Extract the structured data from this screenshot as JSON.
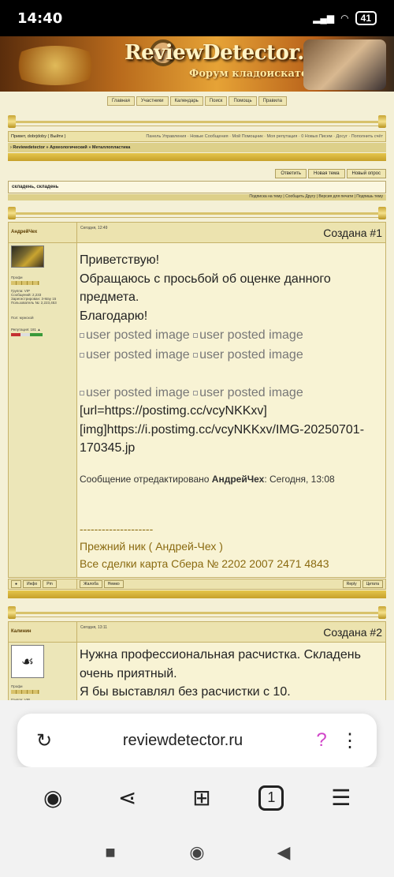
{
  "status": {
    "time": "14:40",
    "battery": "41"
  },
  "banner": {
    "logo": "ReviewDetector.ru",
    "subtitle": "Форум кладоискателей"
  },
  "forum_nav": [
    "Главная",
    "Участники",
    "Календарь",
    "Поиск",
    "Помощь",
    "Правила"
  ],
  "userbar": {
    "left": "Привет, dobrjdoby ( Выйти )",
    "right": "Панель Управления · Новые Сообщения · Мой Помощник · Моя репутация · 0 Новых Писем · Досуг · Пополнить счёт"
  },
  "breadcrumbs": "› Reviewdetector » Археологический » Металлопластика",
  "actions": {
    "reply": "Ответить",
    "new_topic": "Новая тема",
    "new_poll": "Новый опрос"
  },
  "topic_title": "складень, складень",
  "topic_options": "Подписка на тему | Сообщить Другу | Версия для печати | Подпишь тему",
  "post1": {
    "author": "АндрейЧех",
    "date": "Сегодня, 12:49",
    "created": "Создана #1",
    "rank": "Профи",
    "group": "Группа: VIP",
    "messages": "Сообщений: 2,233",
    "registered": "Зарегистрирован: 3-May 15",
    "usernum": "Пользователь №: 2,223,453",
    "gender": "Пол: мужской",
    "rep": "Репутация: 181 ▲",
    "greeting": "Приветствую!",
    "request": "Обращаюсь с просьбой об оценке данного предмета.",
    "thanks": "Благодарю!",
    "img_alt": "user posted image",
    "url_line": "[url=https://postimg.cc/vcyNKKxv]",
    "img_line": "[img]https://i.postimg.cc/vcyNKKxv/IMG-20250701-170345.jp",
    "edited_prefix": "Сообщение отредактировано",
    "edited_author": "АндрейЧех",
    "edited_time": ": Сегодня, 13:08",
    "sig_dash": "--------------------",
    "sig_nick": "Прежний ник ( Андрей-Чех )",
    "sig_card": "Все сделки карта Сбера № 2202 2007 2471 4843"
  },
  "post1_foot": {
    "info": "Инфо",
    "pm": "Pm",
    "complaint": "Жалоба",
    "ip": "Немко",
    "reply": "Reply",
    "quote": "Цитата"
  },
  "post2": {
    "author": "Калинин",
    "date": "Сегодня, 13:11",
    "created": "Создана #2",
    "rank": "Профи",
    "group": "Группа: VIP",
    "line1": "Нужна профессиональная расчистка. Складень очень приятный.",
    "line2": "Я бы выставлял без расчистки с 10."
  },
  "browser": {
    "url": "reviewdetector.ru",
    "tabs": "1"
  }
}
